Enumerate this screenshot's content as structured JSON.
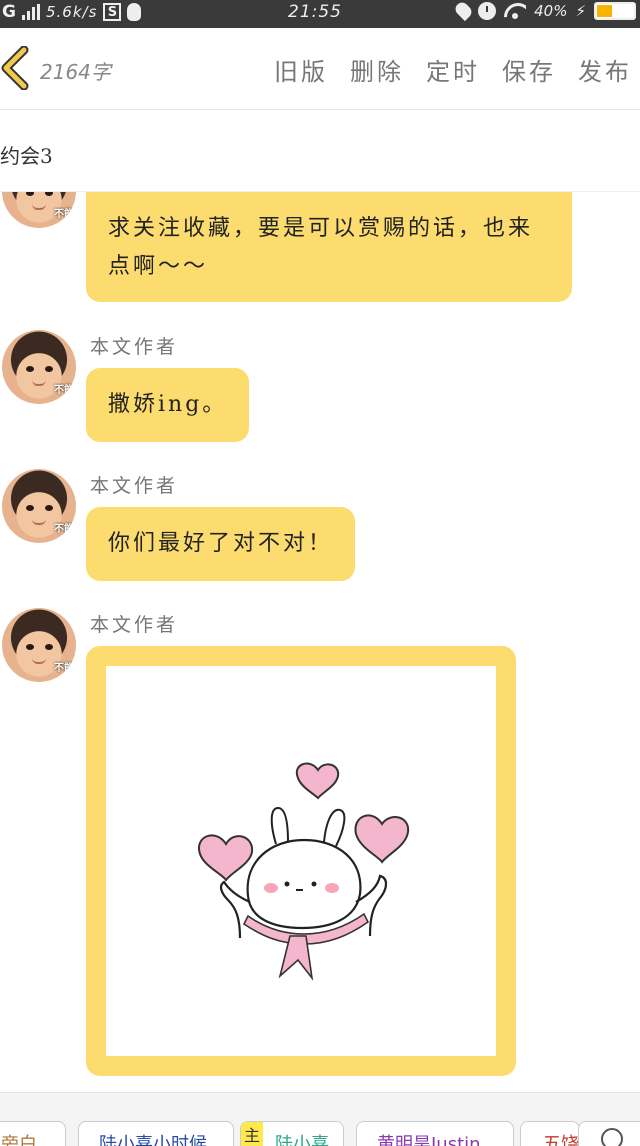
{
  "status_bar": {
    "carrier": "G",
    "net_speed": "5.6k/s",
    "badge": "S",
    "time": "21:55",
    "battery": "40%",
    "battery_level": 0.4
  },
  "header": {
    "word_count": "2164字",
    "actions": [
      "旧版",
      "删除",
      "定时",
      "保存",
      "发布"
    ]
  },
  "chapter_title": "约会3",
  "messages": [
    {
      "sender": "",
      "text": "求关注收藏，要是可以赏赐的话，也来点啊～～"
    },
    {
      "sender": "本文作者",
      "text": "撒娇ing。"
    },
    {
      "sender": "本文作者",
      "text": "你们最好了对不对！"
    },
    {
      "sender": "本文作者",
      "image": "bunny-sticker"
    }
  ],
  "avatar_tag": "不能",
  "bottom_chips": [
    {
      "label": "旁白",
      "color": "#b07a3a"
    },
    {
      "label": "陆小喜小时候",
      "color": "#2a4aa8"
    },
    {
      "label": "主",
      "color": "#333333",
      "bg": "#ffe94a"
    },
    {
      "label": "陆小喜",
      "color": "#2aa88a"
    },
    {
      "label": "黄明昊Justin",
      "color": "#8a3ab0"
    },
    {
      "label": "五饶",
      "color": "#c0392b"
    }
  ],
  "colors": {
    "bubble": "#fcdc6e",
    "accent_back": "#f2c94c"
  }
}
